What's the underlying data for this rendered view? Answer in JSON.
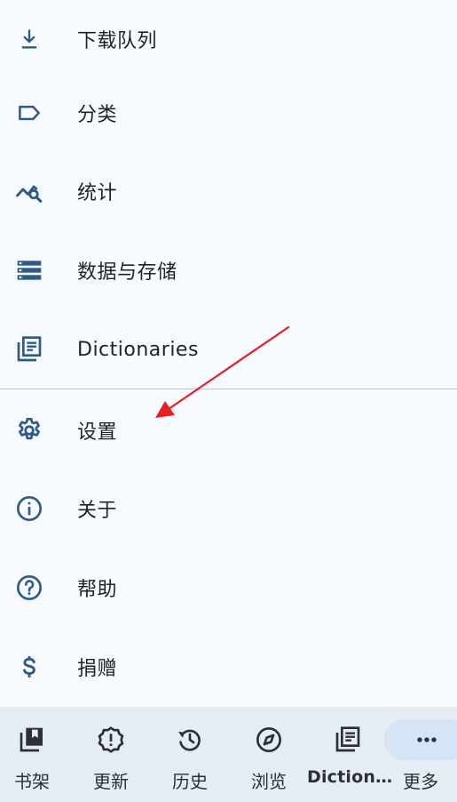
{
  "colors": {
    "background": "#f7faff",
    "icon": "#2e5b86",
    "text": "#1d2327",
    "divider": "#c3c7cc",
    "bottom_nav_bg": "#e6ecf3",
    "active_pill": "#d6e4f7",
    "annotation_arrow": "#e3211f"
  },
  "menu": {
    "items": [
      {
        "label": "下载队列",
        "icon": "download-icon"
      },
      {
        "label": "分类",
        "icon": "label-tag-icon"
      },
      {
        "label": "统计",
        "icon": "query-stats-icon"
      },
      {
        "label": "数据与存储",
        "icon": "storage-icon"
      },
      {
        "label": "Dictionaries",
        "icon": "library-books-icon"
      },
      {
        "label": "设置",
        "icon": "settings-gear-icon"
      },
      {
        "label": "关于",
        "icon": "info-icon"
      },
      {
        "label": "帮助",
        "icon": "help-icon"
      },
      {
        "label": "捐赠",
        "icon": "dollar-icon"
      }
    ]
  },
  "bottom_nav": {
    "items": [
      {
        "label": "书架",
        "icon": "bookshelf-icon",
        "active": false
      },
      {
        "label": "更新",
        "icon": "new-releases-icon",
        "active": false
      },
      {
        "label": "历史",
        "icon": "history-icon",
        "active": false
      },
      {
        "label": "浏览",
        "icon": "explore-icon",
        "active": false
      },
      {
        "label": "Diction…",
        "icon": "dictionaries-icon",
        "active": false
      },
      {
        "label": "更多",
        "icon": "more-horiz-icon",
        "active": true
      }
    ]
  }
}
